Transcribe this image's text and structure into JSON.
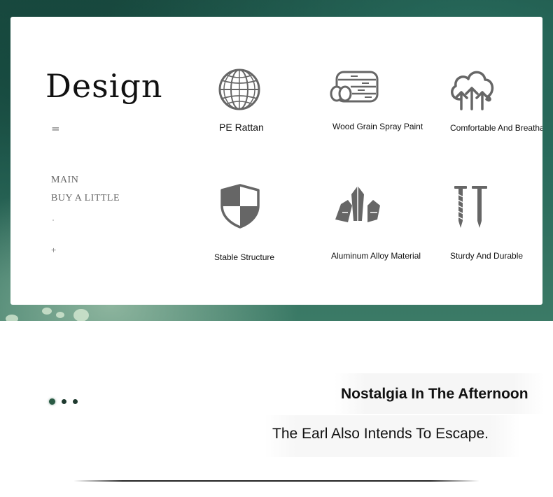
{
  "design": {
    "title": "Design",
    "menu_icon": "=",
    "menu_items": [
      "MAIN",
      "BUY A LITTLE"
    ],
    "plus_icon": "+"
  },
  "features": [
    {
      "icon": "rattan-sphere-icon",
      "label": "PE Rattan"
    },
    {
      "icon": "wood-logs-icon",
      "label": "Wood Grain Spray Paint"
    },
    {
      "icon": "cloud-upload-icon",
      "label": "Comfortable And Breathable"
    },
    {
      "icon": "shield-icon",
      "label": "Stable Structure"
    },
    {
      "icon": "crystals-icon",
      "label": "Aluminum Alloy Material"
    },
    {
      "icon": "nails-icon",
      "label": "Sturdy And Durable"
    }
  ],
  "slider": {
    "dot_count": 3,
    "active_index": 0
  },
  "promo": {
    "headline": "Nostalgia In The Afternoon",
    "subline": "The Earl Also Intends To Escape."
  },
  "colors": {
    "banner_green": "#2a6a5b",
    "icon_gray": "#666666",
    "dot_active": "#2a5a44"
  }
}
